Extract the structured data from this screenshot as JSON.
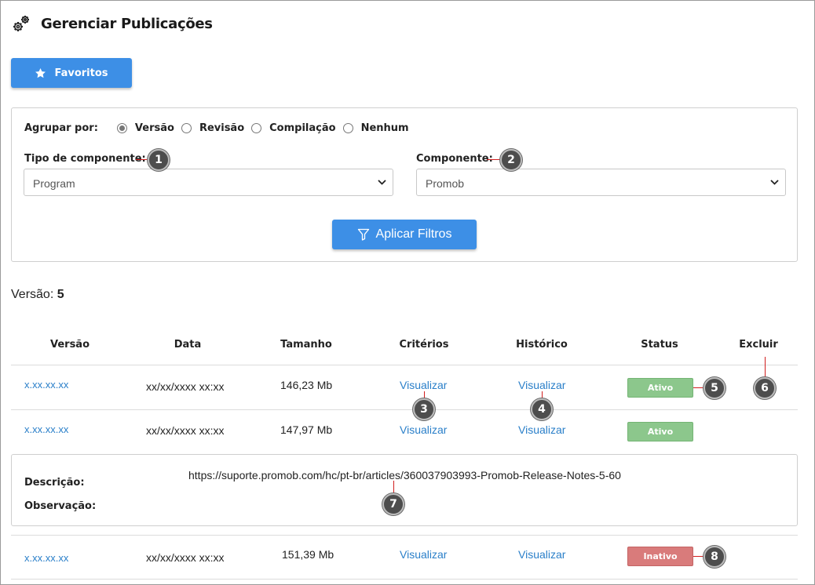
{
  "page": {
    "title": "Gerenciar Publicações"
  },
  "toolbar": {
    "favorites_label": "Favoritos"
  },
  "filters": {
    "group_label": "Agrupar por:",
    "group_options": [
      "Versão",
      "Revisão",
      "Compilação",
      "Nenhum"
    ],
    "group_selected": "Versão",
    "component_type_label": "Tipo de componente:",
    "component_type_value": "Program",
    "component_label": "Componente:",
    "component_value": "Promob",
    "apply_label": "Aplicar Filtros"
  },
  "summary": {
    "label": "Versão:",
    "count": "5"
  },
  "table": {
    "headers": [
      "Versão",
      "Data",
      "Tamanho",
      "Critérios",
      "Histórico",
      "Status",
      "Excluir"
    ],
    "rows": [
      {
        "version": "x.xx.xx.xx",
        "date": "xx/xx/xxxx xx:xx",
        "size": "146,23 Mb",
        "criteria": "Visualizar",
        "history": "Visualizar",
        "status": "Ativo"
      },
      {
        "version": "x.xx.xx.xx",
        "date": "xx/xx/xxxx xx:xx",
        "size": "147,97 Mb",
        "criteria": "Visualizar",
        "history": "Visualizar",
        "status": "Ativo"
      },
      {
        "version": "x.xx.xx.xx",
        "date": "xx/xx/xxxx xx:xx",
        "size": "151,39 Mb",
        "criteria": "Visualizar",
        "history": "Visualizar",
        "status": "Inativo"
      }
    ]
  },
  "details": {
    "description_label": "Descrição:",
    "observation_label": "Observação:",
    "description_value": "https://suporte.promob.com/hc/pt-br/articles/360037903993-Promob-Release-Notes-5-60"
  },
  "markers": [
    "1",
    "2",
    "3",
    "4",
    "5",
    "6",
    "7",
    "8"
  ],
  "colors": {
    "primary": "#3d8fe6",
    "link": "#2a7fc9",
    "active": "#8cc78c",
    "inactive": "#d97b7b",
    "marker_line": "#d11e1e"
  }
}
